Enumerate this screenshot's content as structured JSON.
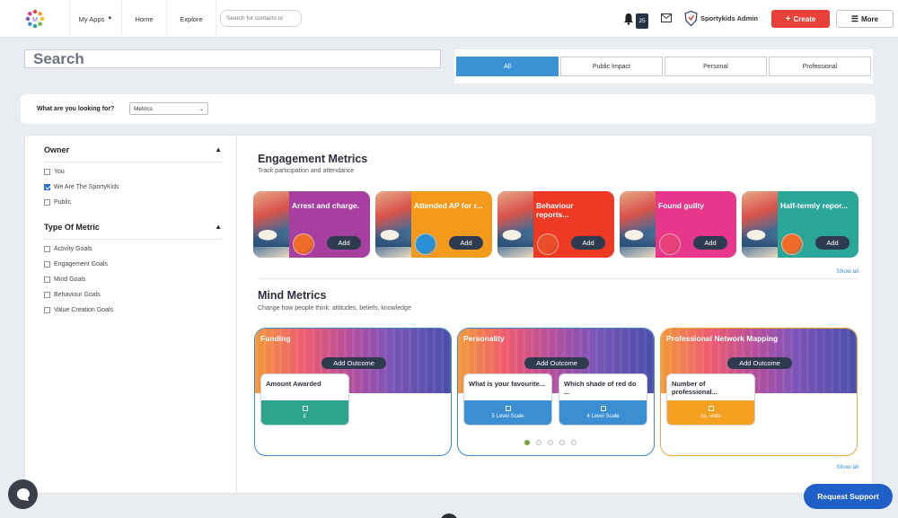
{
  "navbar": {
    "my_apps": "My Apps",
    "home": "Home",
    "explore": "Explore",
    "search_placeholder": "Search for contacts or",
    "notification_count": "25",
    "org_name": "Sportykids Admin",
    "create": "Create",
    "more": "More"
  },
  "search": {
    "placeholder": "Search"
  },
  "filter_tabs": [
    "All",
    "Public Impact",
    "Personal",
    "Professional"
  ],
  "looking_for": {
    "label": "What are you looking for?",
    "selected": "Metrics"
  },
  "sidebar": {
    "owner": {
      "title": "Owner",
      "options": [
        {
          "label": "You",
          "checked": false
        },
        {
          "label": "We Are The SportyKids",
          "checked": true
        },
        {
          "label": "Public",
          "checked": false
        }
      ]
    },
    "type": {
      "title": "Type Of Metric",
      "options": [
        {
          "label": "Activity Goals",
          "checked": false
        },
        {
          "label": "Engagement Goals",
          "checked": false
        },
        {
          "label": "Mind Goals",
          "checked": false
        },
        {
          "label": "Behaviour Goals",
          "checked": false
        },
        {
          "label": "Value Creation Goals",
          "checked": false
        }
      ]
    }
  },
  "engagement": {
    "title": "Engagement Metrics",
    "subtitle": "Track participation and attendance",
    "show_all": "Show all",
    "add_label": "Add",
    "cards": [
      {
        "title": "Arrest and charge.",
        "color": "#a63fa0",
        "ball": "#f06a2a"
      },
      {
        "title": "Attended AP for r...",
        "color": "#f39a1c",
        "ball": "#2a8fd6"
      },
      {
        "title": "Behaviour reports...",
        "color": "#ee3a24",
        "ball": "#e94e2a"
      },
      {
        "title": "Found guilty",
        "color": "#e8368a",
        "ball": "#e8407a"
      },
      {
        "title": "Half-termly repor...",
        "color": "#2ba79a",
        "ball": "#f06a2a"
      }
    ]
  },
  "mind": {
    "title": "Mind Metrics",
    "subtitle": "Change how people think: attitudes, beliefs, knowledge",
    "show_all": "Show all",
    "add_outcome": "Add Outcome",
    "cards": [
      {
        "title": "Funding",
        "border": "#3d8ac9",
        "subs": [
          {
            "title": "Amount Awarded",
            "foot": "£",
            "color": "#2ea48e"
          }
        ]
      },
      {
        "title": "Personality",
        "border": "#3d8ac9",
        "subs": [
          {
            "title": "What is your favourite...",
            "foot": "5 Level Scale",
            "color": "#3a8fd3"
          },
          {
            "title": "Which shade of red do ...",
            "foot": "4 Level Scale",
            "color": "#3a8fd3"
          }
        ]
      },
      {
        "title": "Professional Network Mapping",
        "border": "#f0a640",
        "subs": [
          {
            "title": "Number of professional...",
            "foot": "no. units",
            "color": "#f5a020"
          }
        ]
      }
    ],
    "carousel_dots": 5,
    "active_dot": 0
  },
  "support": {
    "label": "Request Support"
  }
}
